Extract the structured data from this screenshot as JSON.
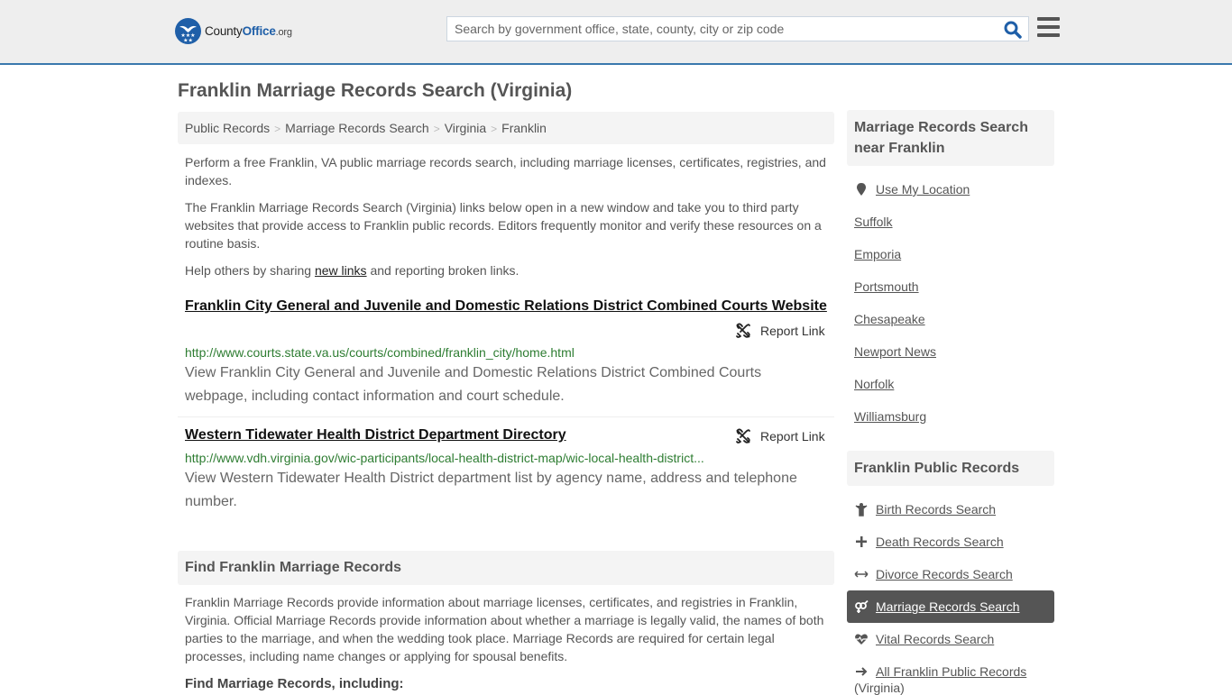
{
  "header": {
    "logo": {
      "county": "County",
      "office": "Office",
      "org": ".org"
    },
    "search_placeholder": "Search by government office, state, county, city or zip code",
    "search_value": ""
  },
  "page_title": "Franklin Marriage Records Search (Virginia)",
  "breadcrumb": [
    {
      "label": "Public Records"
    },
    {
      "label": "Marriage Records Search"
    },
    {
      "label": "Virginia"
    },
    {
      "label": "Franklin"
    }
  ],
  "intro": {
    "p1": "Perform a free Franklin, VA public marriage records search, including marriage licenses, certificates, registries, and indexes.",
    "p2": "The Franklin Marriage Records Search (Virginia) links below open in a new window and take you to third party websites that provide access to Franklin public records. Editors frequently monitor and verify these resources on a routine basis.",
    "p3_before": "Help others by sharing ",
    "p3_link": "new links",
    "p3_after": " and reporting broken links."
  },
  "results": [
    {
      "title": "Franklin City General and Juvenile and Domestic Relations District Combined Courts Website",
      "report_label": "Report Link",
      "url": "http://www.courts.state.va.us/courts/combined/franklin_city/home.html",
      "description": "View Franklin City General and Juvenile and Domestic Relations District Combined Courts webpage, including contact information and court schedule."
    },
    {
      "title": "Western Tidewater Health District Department Directory",
      "report_label": "Report Link",
      "url": "http://www.vdh.virginia.gov/wic-participants/local-health-district-map/wic-local-health-district...",
      "description": "View Western Tidewater Health District department list by agency name, address and telephone number."
    }
  ],
  "find_section": {
    "heading": "Find Franklin Marriage Records",
    "text": "Franklin Marriage Records provide information about marriage licenses, certificates, and registries in Franklin, Virginia. Official Marriage Records provide information about whether a marriage is legally valid, the names of both parties to the marriage, and when the wedding took place. Marriage Records are required for certain legal processes, including name changes or applying for spousal benefits.",
    "subheading": "Find Marriage Records, including:"
  },
  "sidebar": {
    "nearby_heading": "Marriage Records Search near Franklin",
    "use_location": "Use My Location",
    "nearby": [
      "Suffolk",
      "Emporia",
      "Portsmouth",
      "Chesapeake",
      "Newport News",
      "Norfolk",
      "Williamsburg"
    ],
    "public_heading": "Franklin Public Records",
    "public_records": [
      {
        "label": "Birth Records Search",
        "icon": "child-icon",
        "active": false
      },
      {
        "label": "Death Records Search",
        "icon": "cross-icon",
        "active": false
      },
      {
        "label": "Divorce Records Search",
        "icon": "arrows-horizontal-icon",
        "active": false
      },
      {
        "label": "Marriage Records Search",
        "icon": "venus-mars-icon",
        "active": true
      },
      {
        "label": "Vital Records Search",
        "icon": "heartbeat-icon",
        "active": false
      },
      {
        "label": "All Franklin Public Records",
        "icon": "arrow-right-icon",
        "active": false
      }
    ],
    "all_records_suffix": "(Virginia)"
  },
  "colors": {
    "accent": "#3a78ad",
    "brand": "#1f5fa8",
    "url_green": "#2e7d32",
    "active_bg": "#555555"
  }
}
